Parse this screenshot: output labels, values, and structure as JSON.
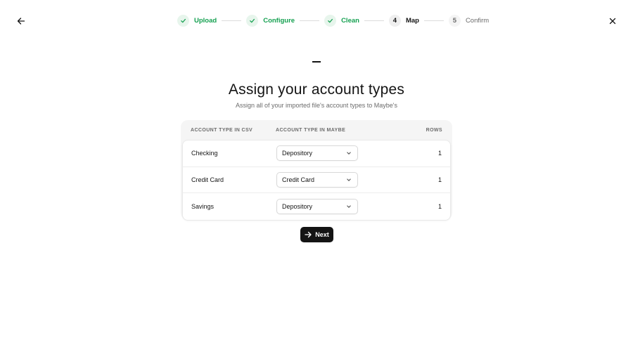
{
  "nav": {
    "back_icon": "arrow-left-icon",
    "close_icon": "close-icon"
  },
  "stepper": {
    "steps": [
      {
        "number": "1",
        "label": "Upload",
        "state": "done"
      },
      {
        "number": "2",
        "label": "Configure",
        "state": "done"
      },
      {
        "number": "3",
        "label": "Clean",
        "state": "done"
      },
      {
        "number": "4",
        "label": "Map",
        "state": "current"
      },
      {
        "number": "5",
        "label": "Confirm",
        "state": "future"
      }
    ]
  },
  "page": {
    "title": "Assign your account types",
    "subtitle": "Assign all of your imported file's account types to Maybe's"
  },
  "table": {
    "headers": {
      "csv": "Account type in CSV",
      "maybe": "Account type in Maybe",
      "rows": "Rows"
    },
    "rows": [
      {
        "csv": "Checking",
        "maybe": "Depository",
        "count": "1"
      },
      {
        "csv": "Credit Card",
        "maybe": "Credit Card",
        "count": "1"
      },
      {
        "csv": "Savings",
        "maybe": "Depository",
        "count": "1"
      }
    ]
  },
  "actions": {
    "next_label": "Next",
    "next_icon": "arrow-right-icon"
  },
  "colors": {
    "done": "#14a050",
    "primary": "#141414",
    "muted": "#6b6b6b"
  }
}
